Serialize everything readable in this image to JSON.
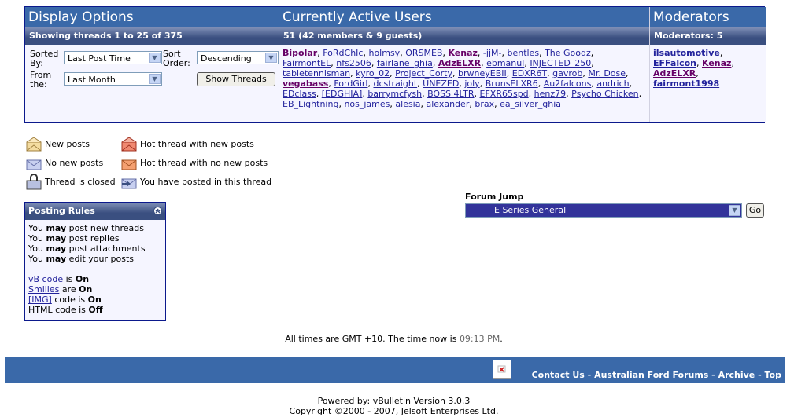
{
  "display_options": {
    "title": "Display Options",
    "showing": "Showing threads 1 to 25 of 375",
    "sorted_by_label": "Sorted By:",
    "sorted_by_value": "Last Post Time",
    "sort_order_label": "Sort Order:",
    "sort_order_value": "Descending",
    "from_label": "From the:",
    "from_value": "Last Month",
    "show_button": "Show Threads"
  },
  "active_users": {
    "title": "Currently Active Users",
    "summary": "51 (42 members & 9 guests)",
    "users": [
      {
        "name": "Bipolar",
        "style": "bold purple"
      },
      {
        "name": "FoRdChIc"
      },
      {
        "name": "holmsy"
      },
      {
        "name": "ORSMEB"
      },
      {
        "name": "Kenaz",
        "style": "bold purple"
      },
      {
        "name": "-jjM-"
      },
      {
        "name": "bentles"
      },
      {
        "name": "The Goodz"
      },
      {
        "name": "FairmontEL"
      },
      {
        "name": "nfs2506"
      },
      {
        "name": "fairlane_ghia"
      },
      {
        "name": "AdzELXR",
        "style": "bold purple"
      },
      {
        "name": "ebmanul"
      },
      {
        "name": "INJECTED_250"
      },
      {
        "name": "tabletennisman"
      },
      {
        "name": "kyro_02"
      },
      {
        "name": "Project_Corty"
      },
      {
        "name": "brwneyEBII"
      },
      {
        "name": "EDXR6T"
      },
      {
        "name": "gavrob"
      },
      {
        "name": "Mr. Dose"
      },
      {
        "name": "vegabass",
        "style": "bold purple"
      },
      {
        "name": "FordGirl"
      },
      {
        "name": "dcstraight"
      },
      {
        "name": "UNEZED"
      },
      {
        "name": "joly"
      },
      {
        "name": "BrunsELXR6"
      },
      {
        "name": "Au2falcons"
      },
      {
        "name": "andrich"
      },
      {
        "name": "EDclass"
      },
      {
        "name": "[EDGHIA]"
      },
      {
        "name": "barrymcfysh"
      },
      {
        "name": "BOSS 4LTR"
      },
      {
        "name": "EFXR65spd"
      },
      {
        "name": "henz79"
      },
      {
        "name": "Psycho Chicken"
      },
      {
        "name": "EB_Lightning"
      },
      {
        "name": "nos_james"
      },
      {
        "name": "alesia"
      },
      {
        "name": "alexander"
      },
      {
        "name": "brax"
      },
      {
        "name": "ea_silver_ghia"
      }
    ]
  },
  "moderators": {
    "title": "Moderators",
    "summary": "Moderators: 5",
    "list": [
      {
        "name": "ilsautomotive",
        "style": "bold"
      },
      {
        "name": "EFFalcon",
        "style": "bold"
      },
      {
        "name": "Kenaz",
        "style": "bold purple"
      },
      {
        "name": "AdzELXR",
        "style": "bold purple"
      },
      {
        "name": "fairmont1998",
        "style": "bold"
      }
    ]
  },
  "legend": {
    "new_posts": "New posts",
    "no_new_posts": "No new posts",
    "thread_closed": "Thread is closed",
    "hot_new": "Hot thread with new posts",
    "hot_no_new": "Hot thread with no new posts",
    "posted_in": "You have posted in this thread"
  },
  "posting_rules": {
    "title": "Posting Rules",
    "rules": [
      {
        "pre": "You ",
        "bold": "may",
        "post": " post new threads"
      },
      {
        "pre": "You ",
        "bold": "may",
        "post": " post replies"
      },
      {
        "pre": "You ",
        "bold": "may",
        "post": " post attachments"
      },
      {
        "pre": "You ",
        "bold": "may",
        "post": " edit your posts"
      }
    ],
    "vb_code_link": "vB code",
    "vb_code_text": " is ",
    "vb_code_state": "On",
    "smilies_link": "Smilies",
    "smilies_text": " are ",
    "smilies_state": "On",
    "img_link": "[IMG]",
    "img_text": " code is ",
    "img_state": "On",
    "html_text": "HTML code is ",
    "html_state": "Off"
  },
  "forum_jump": {
    "label": "Forum Jump",
    "selected": "E Series General",
    "go": "Go"
  },
  "times": {
    "prefix": "All times are GMT +10. The time now is ",
    "now": "09:13 PM",
    "suffix": "."
  },
  "footer": {
    "contact": "Contact Us",
    "site": "Australian Ford Forums",
    "archive": "Archive",
    "top": "Top",
    "sep": " - "
  },
  "powered": {
    "line1": "Powered by: vBulletin Version 3.0.3",
    "line2": "Copyright ©2000 - 2007, Jelsoft Enterprises Ltd."
  },
  "colors": {
    "header_blue": "#3a69a9",
    "cat_dark": "#3a4f80",
    "border_navy": "#0b198c",
    "link": "#22229c",
    "bold_user": "#660066",
    "forum_jump_bg": "#32339a"
  }
}
